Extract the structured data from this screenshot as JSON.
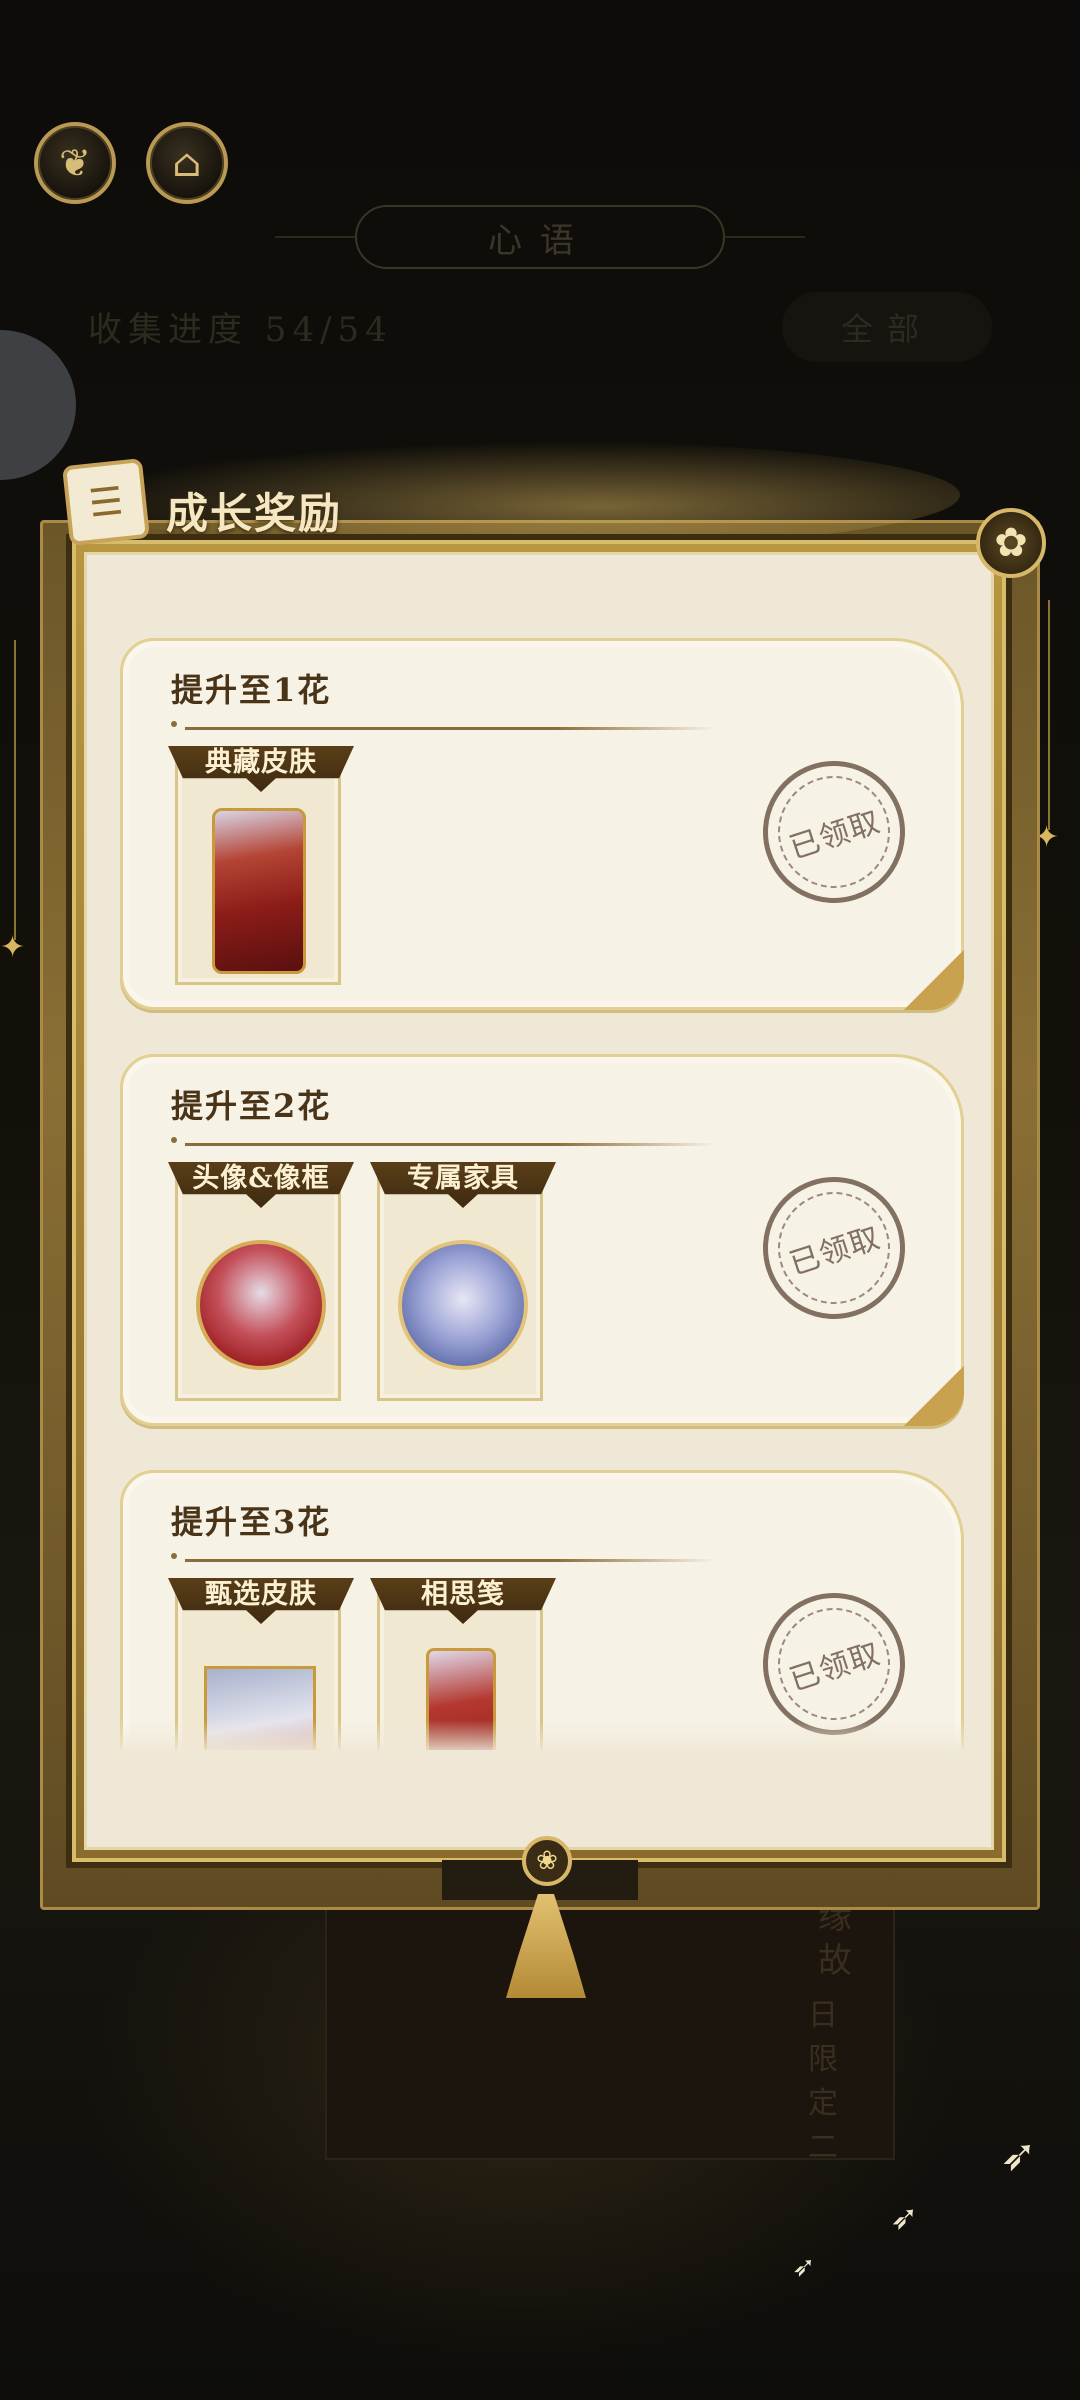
{
  "background": {
    "top_icons": [
      "leaf-emblem-icon",
      "pavilion-icon"
    ],
    "page_title": "心语",
    "progress_label": "收集进度 54/54",
    "filter_label": "全部",
    "card_text": "缘故",
    "card_text2": "日限定二"
  },
  "modal": {
    "title": "成长奖励",
    "close_icon": "flower-close-icon",
    "tiers": [
      {
        "title": "提升至1花",
        "rewards": [
          {
            "label": "典藏皮肤",
            "type": "portrait"
          }
        ],
        "stamp": "已领取"
      },
      {
        "title": "提升至2花",
        "rewards": [
          {
            "label": "头像&像框",
            "type": "avatar-frame"
          },
          {
            "label": "专属家具",
            "type": "furniture"
          }
        ],
        "stamp": "已领取"
      },
      {
        "title": "提升至3花",
        "rewards": [
          {
            "label": "甄选皮肤",
            "type": "skin"
          },
          {
            "label": "相思笺",
            "type": "letter-card"
          }
        ],
        "stamp": "已领取"
      }
    ]
  },
  "colors": {
    "accent_gold": "#d7bc6c",
    "panel_bg": "#efe8d6",
    "title_brown": "#4a3418",
    "stamp_ink": "#6e5a4a"
  }
}
